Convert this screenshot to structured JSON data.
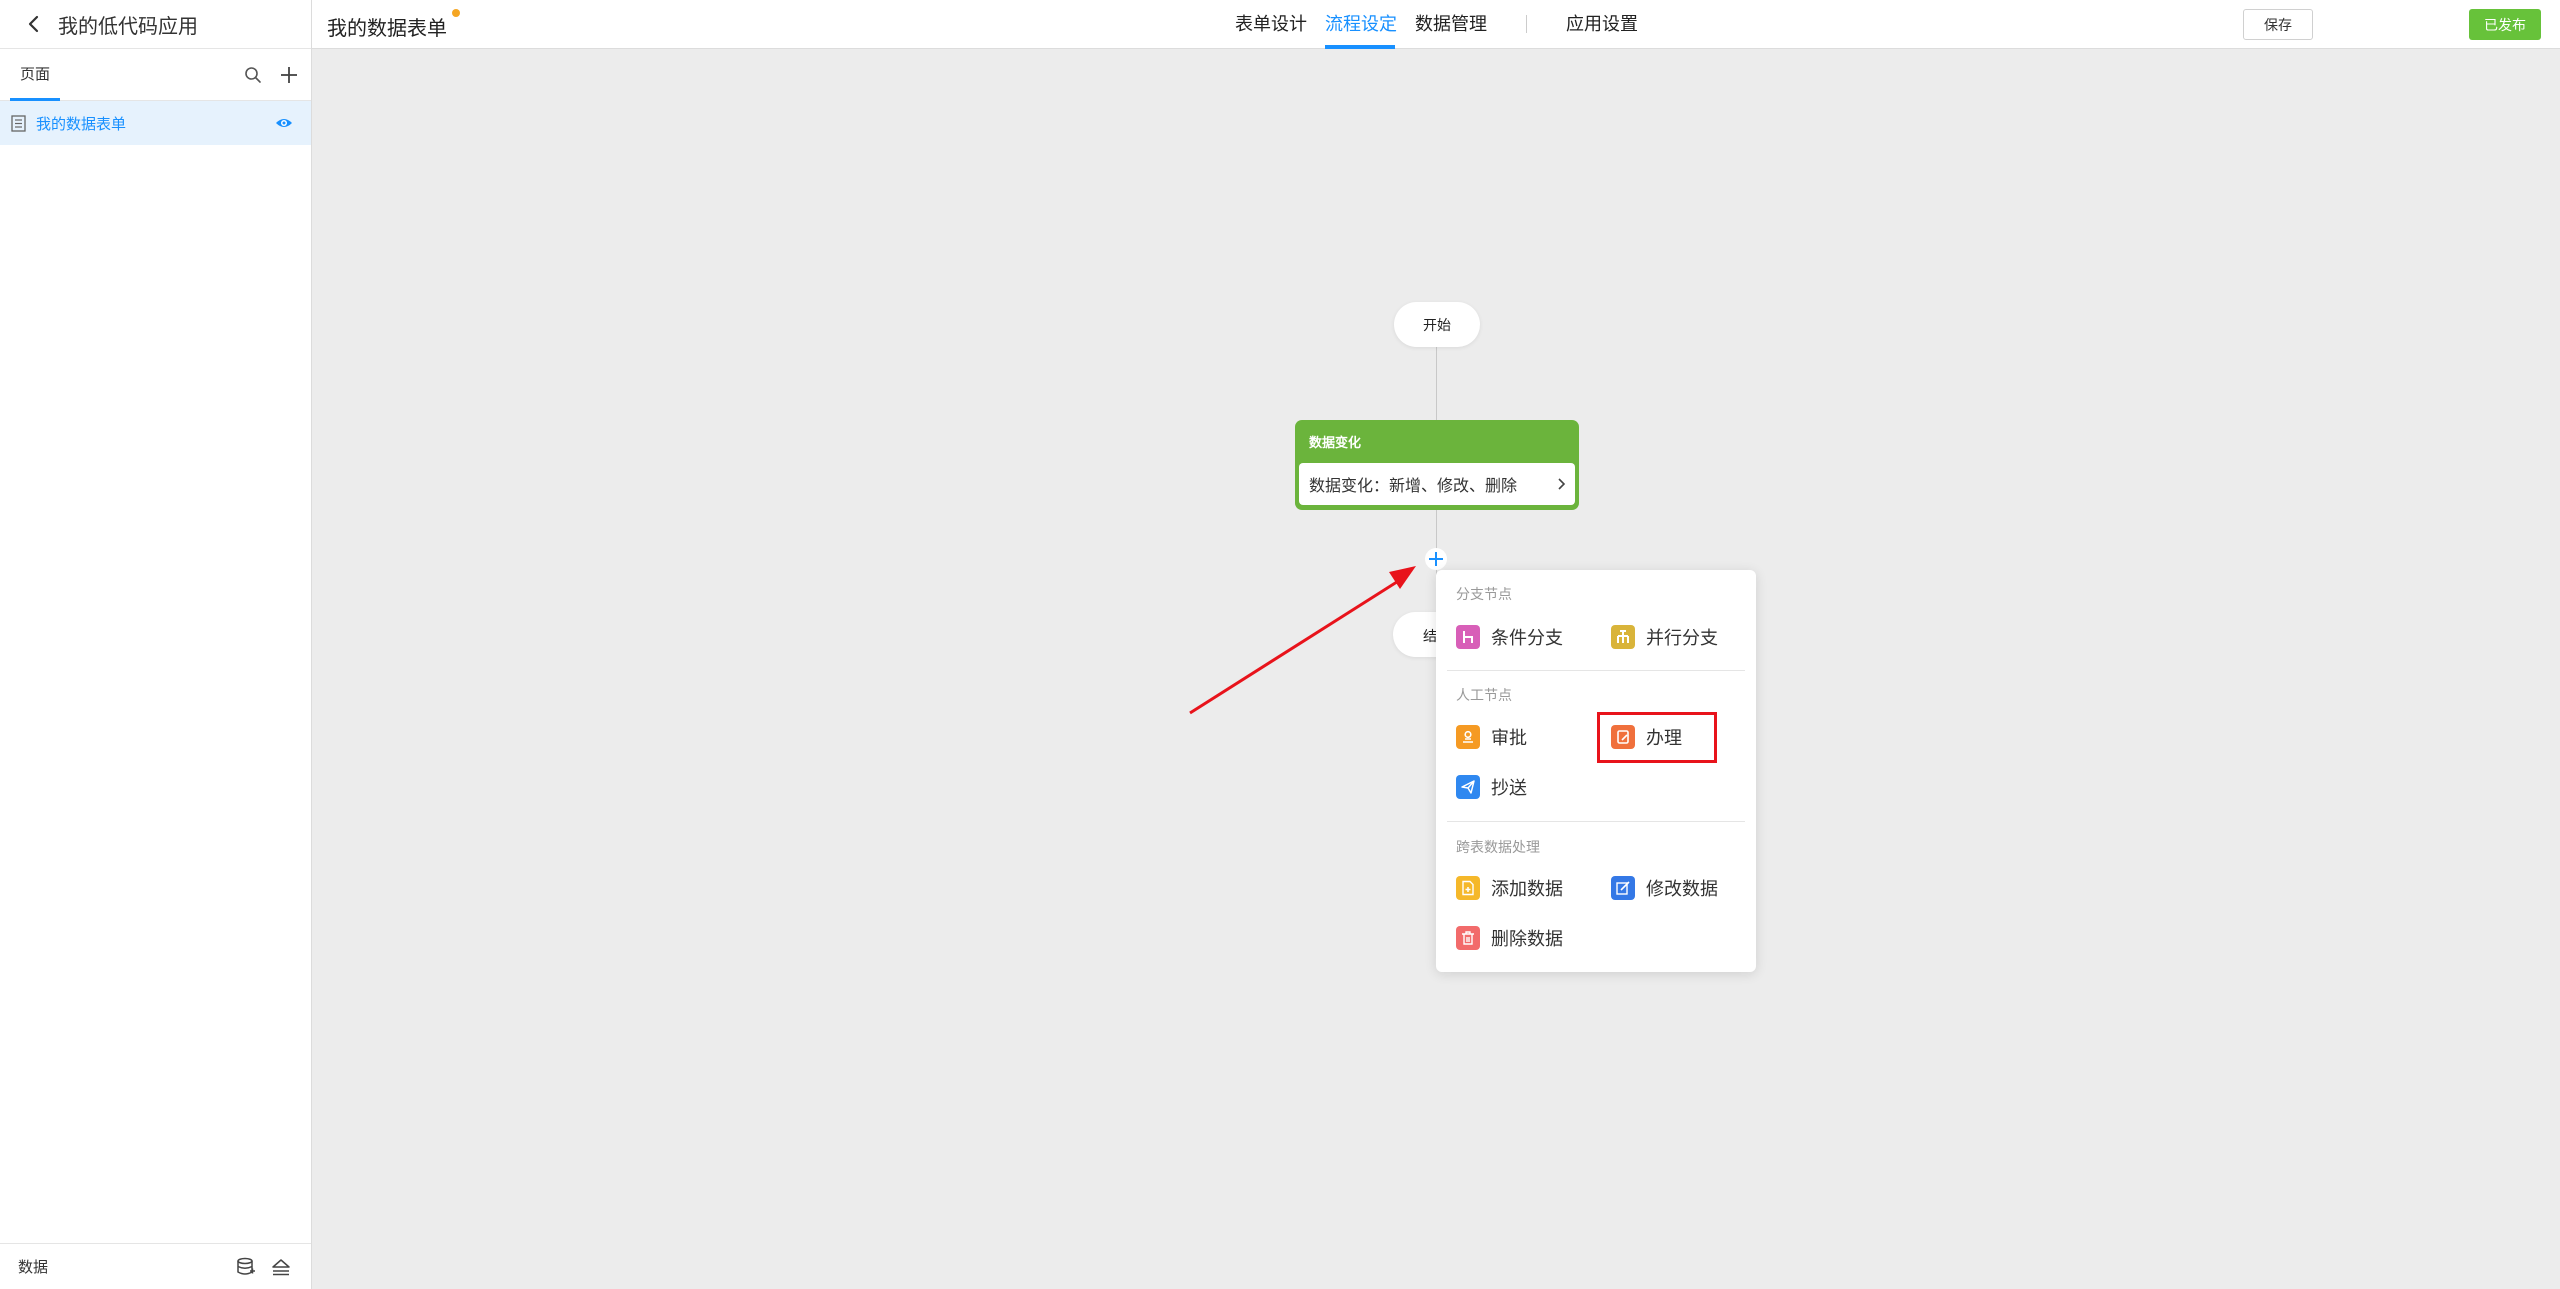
{
  "sidebar": {
    "app_title": "我的低代码应用",
    "tab_label": "页面",
    "pages": [
      {
        "label": "我的数据表单"
      }
    ],
    "footer_label": "数据"
  },
  "topbar": {
    "form_title": "我的数据表单",
    "tabs": [
      {
        "label": "表单设计",
        "active": false
      },
      {
        "label": "流程设定",
        "active": true
      },
      {
        "label": "数据管理",
        "active": false
      },
      {
        "label": "应用设置",
        "active": false
      }
    ],
    "save_label": "保存",
    "publish_label": "已发布"
  },
  "flow": {
    "start_label": "开始",
    "trigger_title": "数据变化",
    "trigger_desc": "数据变化：新增、修改、删除",
    "end_label_partial": "结"
  },
  "menu": {
    "sections": [
      {
        "title": "分支节点",
        "items": [
          {
            "label": "条件分支",
            "icon": "condition-branch-icon",
            "color": "#d85fb8"
          },
          {
            "label": "并行分支",
            "icon": "parallel-branch-icon",
            "color": "#d9b43a"
          }
        ]
      },
      {
        "title": "人工节点",
        "items": [
          {
            "label": "审批",
            "icon": "approve-icon",
            "color": "#f59a23"
          },
          {
            "label": "办理",
            "icon": "handle-icon",
            "color": "#f0703c",
            "highlighted": true
          },
          {
            "label": "抄送",
            "icon": "cc-send-icon",
            "color": "#2f88f0"
          }
        ]
      },
      {
        "title": "跨表数据处理",
        "items": [
          {
            "label": "添加数据",
            "icon": "add-data-icon",
            "color": "#f5b82a"
          },
          {
            "label": "修改数据",
            "icon": "edit-data-icon",
            "color": "#3478e6"
          },
          {
            "label": "删除数据",
            "icon": "delete-data-icon",
            "color": "#f26b6b"
          }
        ]
      }
    ]
  },
  "colors": {
    "accent": "#1890ff",
    "publish": "#67c23a",
    "trigger": "#6bb43c",
    "annotation": "#e8131b",
    "unsaved_dot": "#f5a623"
  }
}
